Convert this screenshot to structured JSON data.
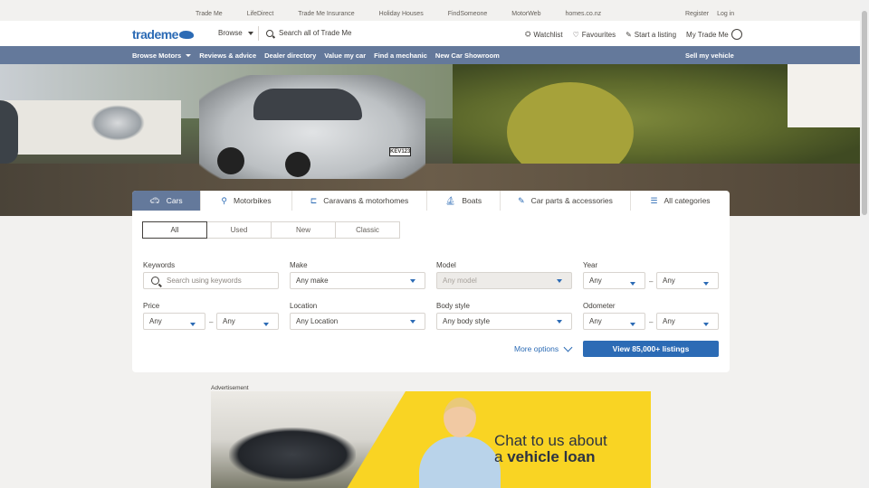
{
  "topbar": {
    "sites": [
      "Trade Me",
      "LifeDirect",
      "Trade Me Insurance",
      "Holiday Houses",
      "FindSomeone",
      "MotorWeb",
      "homes.co.nz"
    ],
    "register": "Register",
    "login": "Log in"
  },
  "header": {
    "logo": "trademe",
    "browse": "Browse",
    "search_placeholder": "Search all of Trade Me",
    "watchlist": "Watchlist",
    "favourites": "Favourites",
    "start_listing": "Start a listing",
    "my_trade_me": "My Trade Me"
  },
  "nav": {
    "items": [
      "Browse Motors",
      "Reviews & advice",
      "Dealer directory",
      "Value my car",
      "Find a mechanic",
      "New Car Showroom"
    ],
    "sell": "Sell my vehicle"
  },
  "hero": {
    "plate": "KEV123"
  },
  "tabs": [
    {
      "label": "Cars",
      "icon": "car-icon",
      "active": true
    },
    {
      "label": "Motorbikes",
      "icon": "motorbike-icon",
      "active": false
    },
    {
      "label": "Caravans & motorhomes",
      "icon": "caravan-icon",
      "active": false
    },
    {
      "label": "Boats",
      "icon": "boat-icon",
      "active": false
    },
    {
      "label": "Car parts & accessories",
      "icon": "wrench-icon",
      "active": false
    },
    {
      "label": "All categories",
      "icon": "list-icon",
      "active": false
    }
  ],
  "condition": {
    "options": [
      "All",
      "Used",
      "New",
      "Classic"
    ],
    "selected": "All"
  },
  "form": {
    "keywords_label": "Keywords",
    "keywords_placeholder": "Search using keywords",
    "make_label": "Make",
    "make_value": "Any make",
    "model_label": "Model",
    "model_value": "Any model",
    "year_label": "Year",
    "year_from": "Any",
    "year_to": "Any",
    "price_label": "Price",
    "price_from": "Any",
    "price_to": "Any",
    "location_label": "Location",
    "location_value": "Any Location",
    "body_label": "Body style",
    "body_value": "Any body style",
    "odometer_label": "Odometer",
    "odo_from": "Any",
    "odo_to": "Any",
    "range_sep": "–",
    "more_options": "More options",
    "view_button": "View 85,000+ listings"
  },
  "ad": {
    "label": "Advertisement",
    "line1": "Chat to us about",
    "line2_prefix": "a",
    "line2_bold": "vehicle loan"
  },
  "colors": {
    "brand": "#2c6bb5",
    "nav": "#64799b",
    "ad_bg": "#f9d423"
  }
}
